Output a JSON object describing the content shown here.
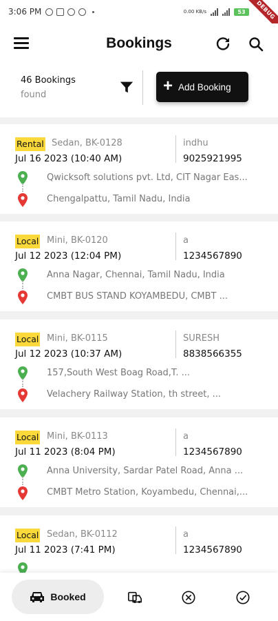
{
  "status_bar": {
    "time": "3:06 PM",
    "network": "0.00 KB/s",
    "battery": "53",
    "debug_banner": "DEBUG"
  },
  "header": {
    "title": "Bookings",
    "menu_icon": "menu-icon",
    "refresh_icon": "refresh-icon",
    "search_icon": "search-icon"
  },
  "summary": {
    "count_line1": "46 Bookings",
    "count_line2": "found",
    "add_button_label": "Add Booking"
  },
  "bookings": [
    {
      "type": "Rental",
      "vehicle": "Sedan, BK-0128",
      "datetime": "Jul 16 2023 (10:40 AM)",
      "customer": "indhu",
      "phone": "9025921995",
      "pickup": "Qwicksoft solutions pvt. Ltd, CIT Nagar Eas...",
      "drop": "Chengalpattu, Tamil Nadu, India"
    },
    {
      "type": "Local",
      "vehicle": "Mini, BK-0120",
      "datetime": "Jul 12 2023 (12:04 PM)",
      "customer": "a",
      "phone": "1234567890",
      "pickup": "Anna Nagar, Chennai, Tamil Nadu, India",
      "drop": "CMBT BUS STAND KOYAMBEDU, CMBT ..."
    },
    {
      "type": "Local",
      "vehicle": "Mini, BK-0115",
      "datetime": "Jul 12 2023 (10:37 AM)",
      "customer": "SURESH",
      "phone": "8838566355",
      "pickup": "157,South West Boag Road,T. ...",
      "drop": "Velachery Railway Station, th street, ..."
    },
    {
      "type": "Local",
      "vehicle": "Mini, BK-0113",
      "datetime": "Jul 11 2023 (8:04 PM)",
      "customer": "a",
      "phone": "1234567890",
      "pickup": "Anna University, Sardar Patel Road, Anna ...",
      "drop": "CMBT Metro Station, Koyambedu, Chennai,..."
    },
    {
      "type": "Local",
      "vehicle": "Sedan, BK-0112",
      "datetime": "Jul 11 2023 (7:41 PM)",
      "customer": "a",
      "phone": "1234567890"
    }
  ],
  "bottom_nav": {
    "booked_label": "Booked"
  },
  "colors": {
    "badge": "#fbd93a",
    "pickup_pin": "#4caf50",
    "drop_pin": "#e53935",
    "primary_button": "#111111"
  }
}
